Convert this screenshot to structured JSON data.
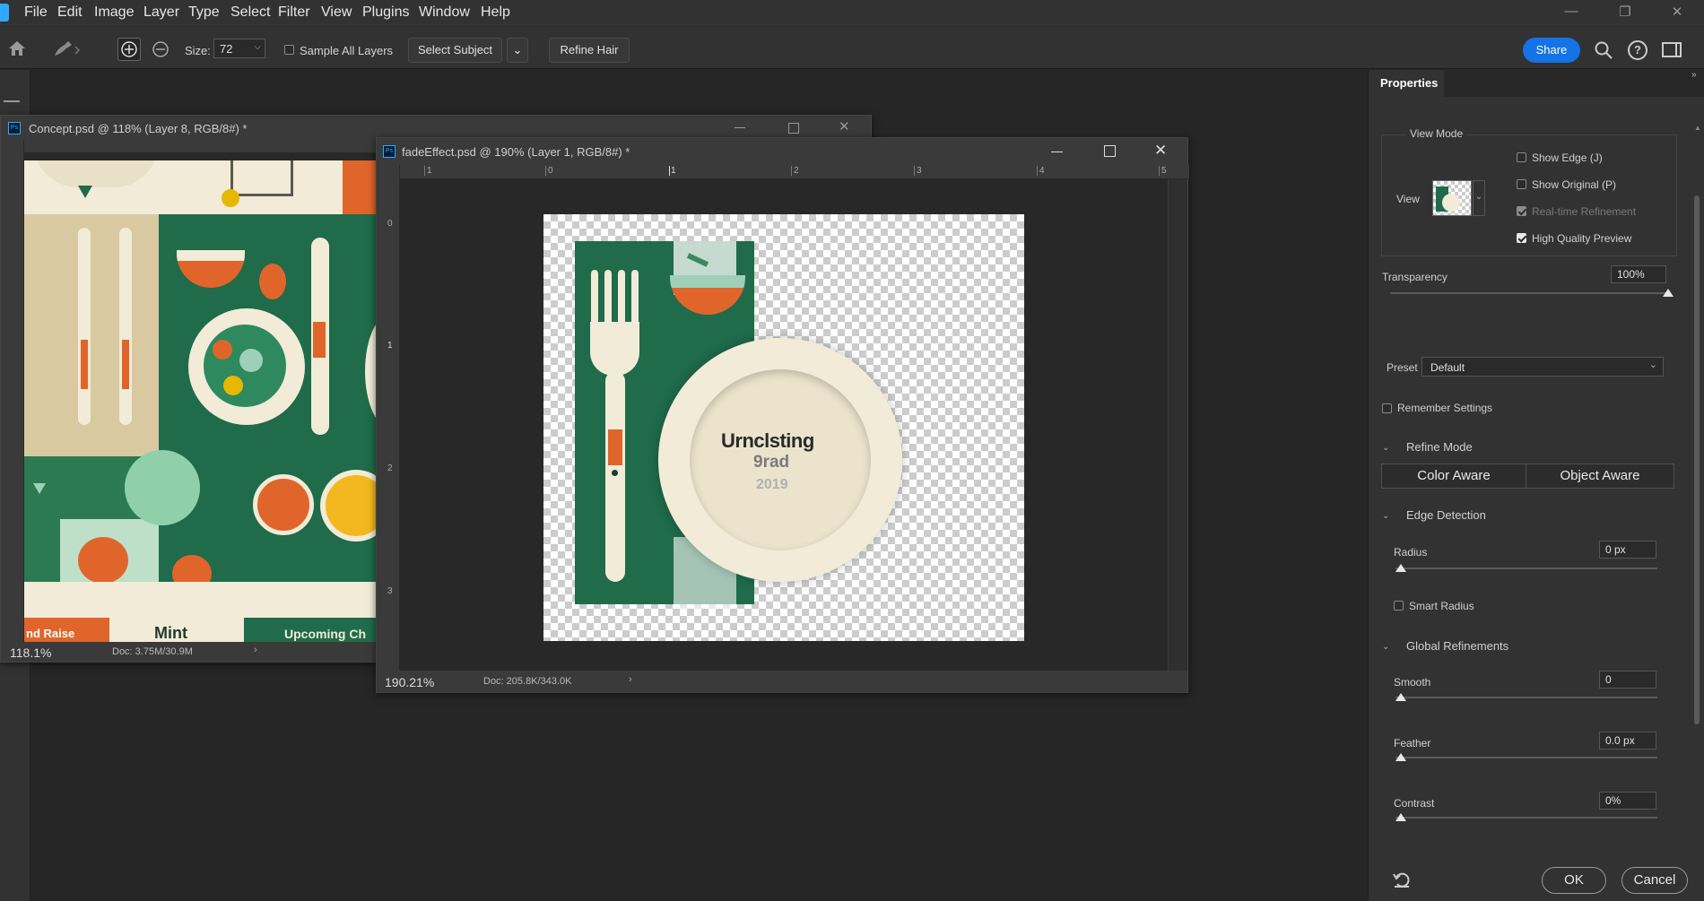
{
  "menubar": {
    "items": [
      "File",
      "Edit",
      "Image",
      "Layer",
      "Type",
      "Select",
      "Filter",
      "View",
      "Plugins",
      "Window",
      "Help"
    ]
  },
  "options": {
    "size_label": "Size:",
    "size_value": "72",
    "sample_all_layers": "Sample All Layers",
    "select_subject": "Select Subject",
    "refine_hair": "Refine Hair",
    "share": "Share"
  },
  "concept_doc": {
    "title": "Concept.psd @ 118% (Layer 8, RGB/8#) *",
    "zoom": "118.1%",
    "doc_info": "Doc: 3.75M/30.9M",
    "bottom_texts": [
      "nd Raise",
      "Mint",
      "Upcoming Ch"
    ]
  },
  "fade_doc": {
    "title": "fadeEffect.psd @ 190% (Layer 1, RGB/8#) *",
    "zoom": "190.21%",
    "doc_info": "Doc: 205.8K/343.0K",
    "ruler_top": [
      "1",
      "0",
      "1",
      "2",
      "3",
      "4",
      "5"
    ],
    "ruler_left": [
      "0",
      "1",
      "2",
      "3"
    ],
    "plate_text": [
      "Urnclsting",
      "9rad",
      "2019"
    ]
  },
  "properties": {
    "tab": "Properties",
    "view_mode": "View Mode",
    "view_label": "View",
    "show_edge": "Show Edge (J)",
    "show_original": "Show Original (P)",
    "realtime": "Real-time Refinement",
    "hq_preview": "High Quality Preview",
    "hq_checked": true,
    "transparency_label": "Transparency",
    "transparency_value": "100%",
    "transparency_level": 1.0,
    "preset_label": "Preset",
    "preset_value": "Default",
    "remember": "Remember Settings",
    "refine_mode": "Refine Mode",
    "color_aware": "Color Aware",
    "object_aware": "Object Aware",
    "edge_detection": "Edge Detection",
    "radius_label": "Radius",
    "radius_value": "0 px",
    "smart_radius": "Smart Radius",
    "global_refinements": "Global Refinements",
    "smooth_label": "Smooth",
    "smooth_value": "0",
    "feather_label": "Feather",
    "feather_value": "0.0 px",
    "contrast_label": "Contrast",
    "contrast_value": "0%",
    "ok": "OK",
    "cancel": "Cancel"
  },
  "colors": {
    "accent": "#1473e6",
    "forest_green": "#1f6b4a",
    "orange": "#e0652a",
    "cream": "#f1ebd8"
  }
}
